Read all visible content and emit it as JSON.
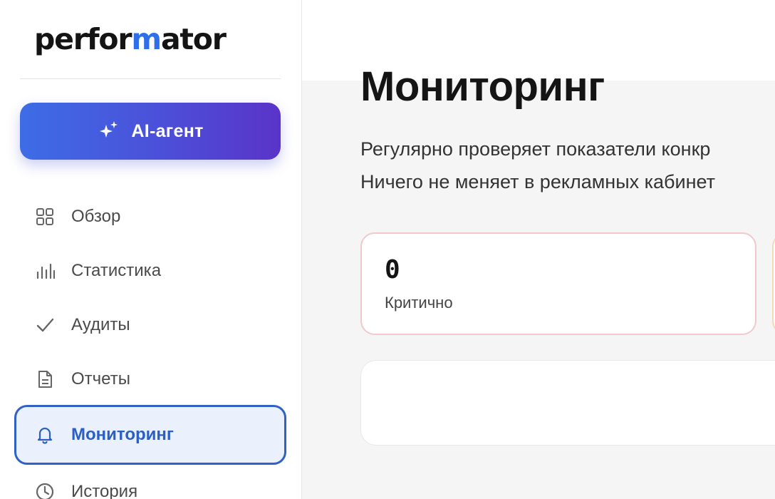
{
  "sidebar": {
    "logo": {
      "prefix": "perfor",
      "accent": "m",
      "suffix": "ator"
    },
    "ai_button": {
      "label": "AI-агент",
      "icon": "sparkle-icon"
    },
    "items": [
      {
        "label": "Обзор",
        "icon": "grid-icon"
      },
      {
        "label": "Статистика",
        "icon": "bar-chart-icon"
      },
      {
        "label": "Аудиты",
        "icon": "checkmark-icon"
      },
      {
        "label": "Отчеты",
        "icon": "document-icon"
      },
      {
        "label": "Мониторинг",
        "icon": "bell-icon",
        "active": true
      },
      {
        "label": "История",
        "icon": "clock-icon"
      }
    ]
  },
  "main": {
    "title": "Мониторинг",
    "description_line1": "Регулярно проверяет показатели конкр",
    "description_line2": "Ничего не меняет в рекламных кабинет",
    "stats": [
      {
        "value": "0",
        "label": "Критично"
      }
    ]
  },
  "colors": {
    "accent": "#2f6ee9",
    "active_border": "#2f62c4",
    "active_bg": "#eaf1fd",
    "ai_gradient_start": "#3d6de6",
    "ai_gradient_end": "#5a34c9",
    "critical_border": "#f1c9cb",
    "warning_border": "#f0dcb6"
  }
}
